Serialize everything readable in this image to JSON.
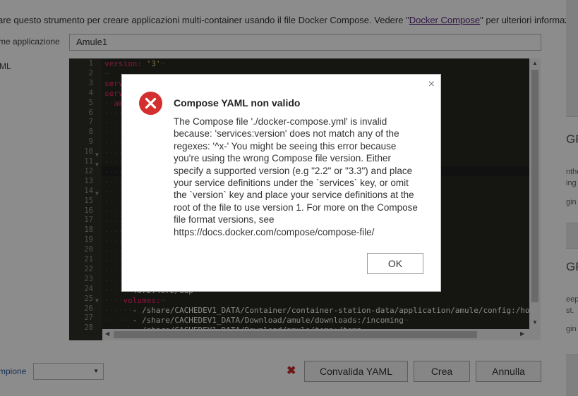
{
  "intro": {
    "text_before": "are questo strumento per creare applicazioni multi-container usando il file Docker Compose. Vedere \"",
    "link": "Docker Compose",
    "text_after": "\" per ulteriori informazioni."
  },
  "form": {
    "app_name_label": "me applicazione",
    "app_name_value": "Amule1",
    "yaml_label": "ML",
    "sample_label": "mpione",
    "sample_value": ""
  },
  "editor": {
    "line_numbers": [
      "1",
      "2",
      "3",
      "4",
      "5",
      "6",
      "7",
      "8",
      "9",
      "10",
      "11",
      "12",
      "13",
      "14",
      "15",
      "16",
      "17",
      "18",
      "19",
      "20",
      "21",
      "22",
      "23",
      "24",
      "25",
      "26",
      "27",
      "28"
    ],
    "visible_code": {
      "line1_key": "version:",
      "line1_value": "'3'",
      "line3": "serv",
      "line4": "serv",
      "line5": "am",
      "line24": "4672:4672/udp",
      "line25": "volumes:",
      "line26": "- /share/CACHEDEV1_DATA/Container/container-station-data/application/amule/config:/ho",
      "line27": "- /share/CACHEDEV1_DATA/Download/amule/downloads:/incoming",
      "line28": "- /share/CACHEDEV1_DATA/Download/amule/temp:/temp"
    }
  },
  "buttons": {
    "validate": "Convalida YAML",
    "create": "Crea",
    "cancel": "Annulla"
  },
  "right_panel": {
    "card1_title": "GP",
    "card1_line1": "ntho",
    "card1_line2": "ing",
    "card1_line3": "gin",
    "card2_title": "GP",
    "card2_line1": "eep",
    "card2_line2": "st.",
    "card2_line3": "gin"
  },
  "modal": {
    "title": "Compose YAML non valido",
    "message": "The Compose file './docker-compose.yml' is invalid because: 'services:version' does not match any of the regexes: '^x-' You might be seeing this error because you're using the wrong Compose file version. Either specify a supported version (e.g \"2.2\" or \"3.3\") and place your service definitions under the `services` key, or omit the `version` key and place your service definitions at the root of the file to use version 1. For more on the Compose file format versions, see https://docs.docker.com/compose/compose-file/",
    "ok_label": "OK",
    "close_glyph": "×"
  },
  "colors": {
    "error_red": "#d32f2f",
    "editor_bg": "#272822",
    "keyword": "#f92672",
    "string": "#e6db74",
    "link": "#5a2a7a"
  }
}
